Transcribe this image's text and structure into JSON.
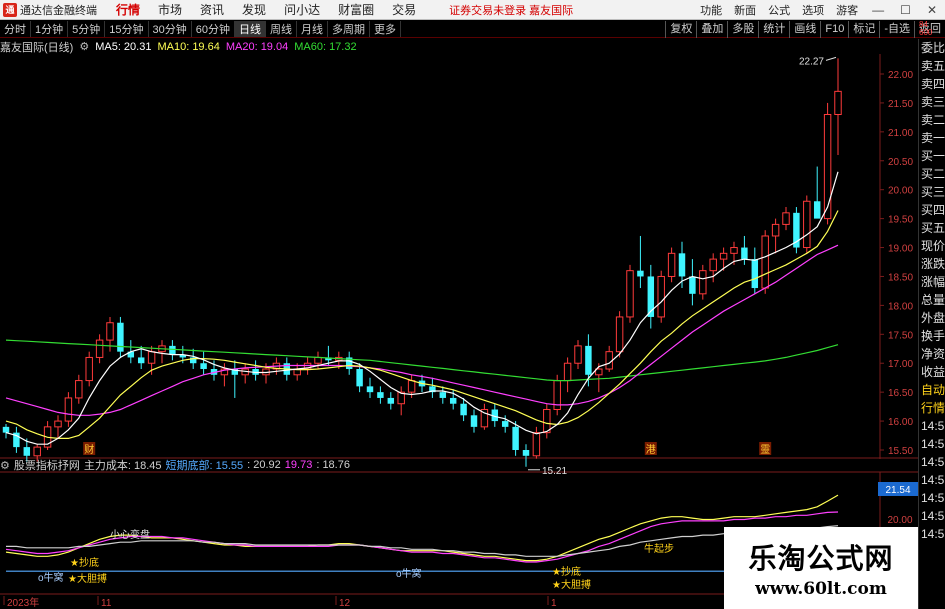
{
  "app": {
    "logo": "通",
    "name": "通达信金融终端"
  },
  "menu": {
    "items": [
      "行情",
      "市场",
      "资讯",
      "发现",
      "问小达",
      "财富圈",
      "交易"
    ],
    "active": 0,
    "notice": "证券交易未登录  嘉友国际"
  },
  "menu_right": [
    "功能",
    "新面",
    "公式",
    "选项",
    "游客"
  ],
  "window_controls": {
    "minimize": "—",
    "maximize": "☐",
    "close": "✕"
  },
  "periods": {
    "items": [
      "分时",
      "1分钟",
      "5分钟",
      "15分钟",
      "30分钟",
      "60分钟",
      "日线",
      "周线",
      "月线",
      "多周期",
      "更多"
    ],
    "active": 6
  },
  "tools": [
    "复权",
    "叠加",
    "多股",
    "统计",
    "画线",
    "F10",
    "标记",
    "-自选",
    "返回"
  ],
  "chart_title": {
    "stock": "嘉友国际(日线)",
    "ma5": "MA5: 20.31",
    "ma10": "MA10: 19.64",
    "ma20": "MA20: 19.04",
    "ma60": "MA60: 17.32"
  },
  "colors": {
    "up": "#ff3b3b",
    "down": "#3ff4ff",
    "ma5": "#ffffff",
    "ma10": "#ffff55",
    "ma20": "#ff40ff",
    "ma60": "#33dd33",
    "cost": "#55aaff"
  },
  "price_axis": [
    "22.00",
    "21.50",
    "21.00",
    "20.50",
    "20.00",
    "19.50",
    "19.00",
    "18.50",
    "18.00",
    "17.50",
    "17.00",
    "16.50",
    "16.00",
    "15.50"
  ],
  "annotations": {
    "high": "22.27",
    "low": "15.21",
    "markers": [
      "财",
      "港",
      "靈"
    ]
  },
  "side_column": [
    "委比",
    "卖五",
    "卖四",
    "卖三",
    "卖二",
    "卖一",
    "买一",
    "买二",
    "买三",
    "买四",
    "买五",
    "现价",
    "涨跌",
    "涨幅",
    "总量",
    "外盘",
    "换手",
    "净资",
    "收益",
    "自动",
    "行情",
    "14:5",
    "14:5",
    "14:5",
    "14:5",
    "14:5",
    "14:5",
    "14:5"
  ],
  "side_column_hl": [
    19,
    20
  ],
  "indicator_title": {
    "name": "股票指标抒网",
    "cost_label": "主力成本: 18.45",
    "bottom_label": "短期底部: 15.55",
    "v1": ": 20.92",
    "v2": "19.73",
    "v3": ": 18.76"
  },
  "indicator_axis": {
    "current": "21.54",
    "level": "20.00"
  },
  "indicator_labels": {
    "caution": "小心变盘",
    "signals": [
      "o牛窝",
      "★大胆搏",
      "★抄底",
      "o牛窝",
      "★抄底",
      "★大胆搏",
      "牛起步"
    ]
  },
  "time_axis": [
    "2023年",
    "11",
    "12",
    "1"
  ],
  "corner_labels": {
    "top1": "84",
    "top2": "600"
  },
  "watermark": {
    "title": "乐淘公式网",
    "url": "www.60lt.com"
  },
  "chart_data": {
    "type": "candlestick",
    "title": "嘉友国际(日线)",
    "ylim": [
      15.2,
      22.4
    ],
    "ohlc": [
      [
        15.9,
        15.95,
        15.7,
        15.8
      ],
      [
        15.8,
        15.9,
        15.45,
        15.55
      ],
      [
        15.55,
        15.7,
        15.3,
        15.4
      ],
      [
        15.4,
        15.6,
        15.3,
        15.55
      ],
      [
        15.55,
        16.0,
        15.5,
        15.9
      ],
      [
        15.9,
        16.1,
        15.7,
        16.0
      ],
      [
        16.0,
        16.5,
        15.9,
        16.4
      ],
      [
        16.4,
        16.8,
        16.3,
        16.7
      ],
      [
        16.7,
        17.2,
        16.6,
        17.1
      ],
      [
        17.1,
        17.5,
        17.0,
        17.4
      ],
      [
        17.4,
        17.8,
        17.2,
        17.7
      ],
      [
        17.7,
        17.8,
        17.1,
        17.2
      ],
      [
        17.2,
        17.4,
        17.0,
        17.1
      ],
      [
        17.1,
        17.3,
        16.9,
        17.0
      ],
      [
        17.0,
        17.3,
        16.8,
        17.2
      ],
      [
        17.2,
        17.4,
        17.0,
        17.3
      ],
      [
        17.3,
        17.4,
        17.05,
        17.15
      ],
      [
        17.15,
        17.3,
        17.0,
        17.1
      ],
      [
        17.1,
        17.25,
        16.9,
        17.0
      ],
      [
        17.0,
        17.2,
        16.8,
        16.9
      ],
      [
        16.9,
        17.05,
        16.7,
        16.8
      ],
      [
        16.8,
        17.0,
        16.6,
        16.9
      ],
      [
        16.9,
        17.05,
        16.4,
        16.8
      ],
      [
        16.8,
        17.0,
        16.65,
        16.9
      ],
      [
        16.9,
        17.05,
        16.7,
        16.8
      ],
      [
        16.8,
        17.0,
        16.65,
        16.9
      ],
      [
        16.9,
        17.1,
        16.8,
        17.0
      ],
      [
        17.0,
        17.1,
        16.7,
        16.8
      ],
      [
        16.8,
        17.0,
        16.7,
        16.9
      ],
      [
        16.9,
        17.1,
        16.8,
        17.0
      ],
      [
        17.0,
        17.2,
        16.9,
        17.1
      ],
      [
        17.1,
        17.3,
        16.95,
        17.05
      ],
      [
        17.05,
        17.2,
        16.9,
        17.1
      ],
      [
        17.1,
        17.2,
        16.8,
        16.9
      ],
      [
        16.9,
        17.0,
        16.5,
        16.6
      ],
      [
        16.6,
        16.75,
        16.4,
        16.5
      ],
      [
        16.5,
        16.6,
        16.3,
        16.4
      ],
      [
        16.4,
        16.5,
        16.2,
        16.3
      ],
      [
        16.3,
        16.6,
        16.1,
        16.5
      ],
      [
        16.5,
        16.8,
        16.4,
        16.7
      ],
      [
        16.7,
        16.8,
        16.5,
        16.6
      ],
      [
        16.6,
        16.75,
        16.4,
        16.5
      ],
      [
        16.5,
        16.6,
        16.3,
        16.4
      ],
      [
        16.4,
        16.55,
        16.2,
        16.3
      ],
      [
        16.3,
        16.4,
        16.0,
        16.1
      ],
      [
        16.1,
        16.2,
        15.8,
        15.9
      ],
      [
        15.9,
        16.3,
        15.85,
        16.2
      ],
      [
        16.2,
        16.3,
        15.9,
        16.0
      ],
      [
        16.0,
        16.1,
        15.8,
        15.9
      ],
      [
        15.9,
        16.0,
        15.4,
        15.5
      ],
      [
        15.5,
        15.6,
        15.21,
        15.4
      ],
      [
        15.4,
        15.9,
        15.35,
        15.8
      ],
      [
        15.8,
        16.3,
        15.7,
        16.2
      ],
      [
        16.2,
        16.8,
        16.1,
        16.7
      ],
      [
        16.7,
        17.1,
        16.5,
        17.0
      ],
      [
        17.0,
        17.4,
        16.9,
        17.3
      ],
      [
        17.3,
        17.5,
        16.6,
        16.8
      ],
      [
        16.8,
        17.0,
        16.5,
        16.9
      ],
      [
        16.9,
        17.3,
        16.85,
        17.2
      ],
      [
        17.2,
        17.9,
        17.1,
        17.8
      ],
      [
        17.8,
        18.7,
        17.7,
        18.6
      ],
      [
        18.6,
        19.2,
        18.3,
        18.5
      ],
      [
        18.5,
        18.7,
        17.6,
        17.8
      ],
      [
        17.8,
        18.6,
        17.7,
        18.5
      ],
      [
        18.5,
        19.0,
        18.4,
        18.9
      ],
      [
        18.9,
        19.1,
        18.3,
        18.5
      ],
      [
        18.5,
        18.8,
        18.0,
        18.2
      ],
      [
        18.2,
        18.7,
        18.1,
        18.6
      ],
      [
        18.6,
        18.9,
        18.4,
        18.8
      ],
      [
        18.8,
        19.0,
        18.6,
        18.9
      ],
      [
        18.9,
        19.1,
        18.7,
        19.0
      ],
      [
        19.0,
        19.2,
        18.7,
        18.8
      ],
      [
        18.8,
        19.0,
        18.2,
        18.3
      ],
      [
        18.3,
        19.3,
        18.2,
        19.2
      ],
      [
        19.2,
        19.5,
        18.9,
        19.4
      ],
      [
        19.4,
        19.7,
        19.3,
        19.6
      ],
      [
        19.6,
        19.7,
        18.9,
        19.0
      ],
      [
        19.0,
        19.9,
        18.9,
        19.8
      ],
      [
        19.8,
        20.4,
        19.6,
        19.5
      ],
      [
        19.5,
        21.5,
        19.4,
        21.3
      ],
      [
        21.3,
        22.27,
        20.6,
        21.7
      ]
    ],
    "ma5": [
      15.8,
      15.75,
      15.65,
      15.6,
      15.6,
      15.7,
      15.85,
      16.05,
      16.4,
      16.7,
      16.95,
      17.1,
      17.2,
      17.25,
      17.2,
      17.17,
      17.15,
      17.15,
      17.12,
      17.06,
      16.98,
      16.92,
      16.88,
      16.86,
      16.84,
      16.84,
      16.86,
      16.88,
      16.9,
      16.92,
      16.96,
      17.0,
      17.04,
      17.04,
      16.98,
      16.86,
      16.72,
      16.58,
      16.48,
      16.46,
      16.48,
      16.52,
      16.52,
      16.48,
      16.38,
      16.24,
      16.14,
      16.08,
      16.04,
      15.94,
      15.84,
      15.78,
      15.82,
      15.94,
      16.14,
      16.46,
      16.74,
      16.94,
      17.0,
      17.16,
      17.4,
      17.7,
      17.9,
      18.06,
      18.26,
      18.42,
      18.5,
      18.46,
      18.5,
      18.64,
      18.76,
      18.8,
      18.78,
      18.84,
      18.92,
      19.0,
      19.1,
      19.22,
      19.36,
      19.7,
      20.31
    ],
    "ma10": [
      16.0,
      15.95,
      15.85,
      15.78,
      15.72,
      15.7,
      15.7,
      15.75,
      15.9,
      16.05,
      16.25,
      16.45,
      16.6,
      16.75,
      16.88,
      16.95,
      17.0,
      17.05,
      17.08,
      17.08,
      17.07,
      17.05,
      17.02,
      16.99,
      16.96,
      16.93,
      16.91,
      16.9,
      16.89,
      16.89,
      16.9,
      16.92,
      16.94,
      16.96,
      16.95,
      16.92,
      16.88,
      16.82,
      16.76,
      16.7,
      16.65,
      16.62,
      16.58,
      16.54,
      16.48,
      16.42,
      16.36,
      16.3,
      16.24,
      16.18,
      16.1,
      16.02,
      15.96,
      15.94,
      15.98,
      16.06,
      16.18,
      16.32,
      16.48,
      16.64,
      16.82,
      17.0,
      17.2,
      17.38,
      17.52,
      17.68,
      17.82,
      17.94,
      18.06,
      18.18,
      18.3,
      18.4,
      18.46,
      18.54,
      18.62,
      18.7,
      18.8,
      18.9,
      19.02,
      19.28,
      19.64
    ],
    "ma20": [
      16.4,
      16.35,
      16.3,
      16.25,
      16.2,
      16.15,
      16.12,
      16.1,
      16.1,
      16.12,
      16.15,
      16.2,
      16.28,
      16.36,
      16.44,
      16.52,
      16.6,
      16.68,
      16.74,
      16.8,
      16.84,
      16.88,
      16.9,
      16.92,
      16.93,
      16.94,
      16.95,
      16.96,
      16.96,
      16.96,
      16.96,
      16.96,
      16.96,
      16.95,
      16.94,
      16.92,
      16.9,
      16.87,
      16.84,
      16.8,
      16.77,
      16.74,
      16.7,
      16.66,
      16.62,
      16.58,
      16.54,
      16.5,
      16.46,
      16.42,
      16.38,
      16.34,
      16.3,
      16.28,
      16.28,
      16.3,
      16.34,
      16.4,
      16.48,
      16.58,
      16.7,
      16.84,
      16.98,
      17.12,
      17.26,
      17.4,
      17.54,
      17.66,
      17.78,
      17.9,
      18.0,
      18.1,
      18.2,
      18.3,
      18.4,
      18.52,
      18.64,
      18.76,
      18.88,
      18.96,
      19.04
    ],
    "ma60": [
      17.4,
      17.39,
      17.38,
      17.37,
      17.36,
      17.35,
      17.34,
      17.33,
      17.32,
      17.31,
      17.3,
      17.29,
      17.28,
      17.27,
      17.26,
      17.25,
      17.24,
      17.23,
      17.22,
      17.21,
      17.2,
      17.19,
      17.18,
      17.17,
      17.16,
      17.15,
      17.14,
      17.13,
      17.12,
      17.11,
      17.1,
      17.09,
      17.08,
      17.07,
      17.06,
      17.05,
      17.03,
      17.01,
      16.99,
      16.97,
      16.95,
      16.93,
      16.91,
      16.89,
      16.87,
      16.85,
      16.83,
      16.81,
      16.79,
      16.77,
      16.75,
      16.73,
      16.71,
      16.7,
      16.7,
      16.71,
      16.72,
      16.73,
      16.74,
      16.76,
      16.78,
      16.8,
      16.82,
      16.84,
      16.86,
      16.88,
      16.9,
      16.92,
      16.94,
      16.96,
      16.98,
      17.0,
      17.02,
      17.04,
      17.07,
      17.1,
      17.14,
      17.18,
      17.22,
      17.27,
      17.32
    ],
    "indicator_series": [
      {
        "name": "主力成本",
        "values": [
          16.9,
          16.8,
          16.7,
          16.6,
          16.6,
          16.7,
          16.9,
          17.2,
          17.5,
          17.8,
          18.0,
          18.1,
          18.1,
          18.0,
          17.9,
          17.9,
          17.9,
          17.8,
          17.7,
          17.6,
          17.5,
          17.4,
          17.4,
          17.3,
          17.3,
          17.3,
          17.3,
          17.3,
          17.3,
          17.3,
          17.4,
          17.4,
          17.5,
          17.5,
          17.4,
          17.3,
          17.2,
          17.1,
          17.0,
          17.0,
          17.0,
          17.0,
          17.0,
          16.9,
          16.8,
          16.7,
          16.6,
          16.6,
          16.5,
          16.4,
          16.3,
          16.3,
          16.4,
          16.6,
          16.9,
          17.2,
          17.5,
          17.8,
          18.0,
          18.3,
          18.6,
          18.9,
          19.1,
          19.3,
          19.4,
          19.4,
          19.3,
          19.2,
          19.2,
          19.3,
          19.4,
          19.4,
          19.4,
          19.5,
          19.6,
          19.7,
          19.8,
          19.9,
          20.1,
          20.5,
          20.92
        ]
      },
      {
        "name": "",
        "values": [
          17.1,
          17.0,
          16.9,
          16.8,
          16.8,
          16.9,
          17.0,
          17.2,
          17.4,
          17.6,
          17.8,
          17.9,
          18.0,
          18.0,
          18.0,
          18.0,
          17.9,
          17.9,
          17.8,
          17.7,
          17.6,
          17.5,
          17.4,
          17.4,
          17.3,
          17.3,
          17.3,
          17.3,
          17.3,
          17.3,
          17.3,
          17.3,
          17.4,
          17.4,
          17.4,
          17.3,
          17.2,
          17.1,
          17.0,
          16.9,
          16.9,
          16.9,
          16.8,
          16.8,
          16.7,
          16.6,
          16.5,
          16.5,
          16.4,
          16.3,
          16.2,
          16.2,
          16.3,
          16.4,
          16.6,
          16.8,
          17.0,
          17.3,
          17.5,
          17.8,
          18.1,
          18.4,
          18.7,
          18.9,
          19.0,
          19.1,
          19.1,
          19.1,
          19.1,
          19.1,
          19.2,
          19.2,
          19.3,
          19.3,
          19.4,
          19.4,
          19.5,
          19.5,
          19.6,
          19.7,
          19.73
        ]
      },
      {
        "name": "",
        "values": [
          17.3,
          17.3,
          17.2,
          17.2,
          17.2,
          17.2,
          17.2,
          17.3,
          17.3,
          17.4,
          17.5,
          17.6,
          17.6,
          17.7,
          17.7,
          17.7,
          17.7,
          17.7,
          17.7,
          17.6,
          17.6,
          17.5,
          17.5,
          17.5,
          17.4,
          17.4,
          17.4,
          17.4,
          17.4,
          17.4,
          17.4,
          17.4,
          17.4,
          17.4,
          17.4,
          17.3,
          17.3,
          17.2,
          17.2,
          17.1,
          17.1,
          17.1,
          17.0,
          17.0,
          16.9,
          16.9,
          16.8,
          16.8,
          16.7,
          16.7,
          16.6,
          16.6,
          16.6,
          16.6,
          16.7,
          16.8,
          16.9,
          17.0,
          17.1,
          17.3,
          17.4,
          17.6,
          17.7,
          17.8,
          17.9,
          18.0,
          18.0,
          18.1,
          18.1,
          18.2,
          18.2,
          18.3,
          18.3,
          18.4,
          18.4,
          18.5,
          18.5,
          18.6,
          18.6,
          18.7,
          18.76
        ]
      },
      {
        "name": "短期底部",
        "values": [
          15.55,
          15.55,
          15.55,
          15.55,
          15.55,
          15.55,
          15.55,
          15.55,
          15.55,
          15.55,
          15.55,
          15.55,
          15.55,
          15.55,
          15.55,
          15.55,
          15.55,
          15.55,
          15.55,
          15.55,
          15.55,
          15.55,
          15.55,
          15.55,
          15.55,
          15.55,
          15.55,
          15.55,
          15.55,
          15.55,
          15.55,
          15.55,
          15.55,
          15.55,
          15.55,
          15.55,
          15.55,
          15.55,
          15.55,
          15.55,
          15.55,
          15.55,
          15.55,
          15.55,
          15.55,
          15.55,
          15.55,
          15.55,
          15.55,
          15.55,
          15.55,
          15.55,
          15.55,
          15.55,
          15.55,
          15.55,
          15.55,
          15.55,
          15.55,
          15.55,
          15.55,
          15.55,
          15.55,
          15.55,
          15.55,
          15.55,
          15.55,
          15.55,
          15.55,
          15.55,
          15.55,
          15.55,
          15.55,
          15.55,
          15.55,
          15.55,
          15.55,
          15.55,
          15.55,
          15.55,
          15.55
        ]
      }
    ]
  }
}
